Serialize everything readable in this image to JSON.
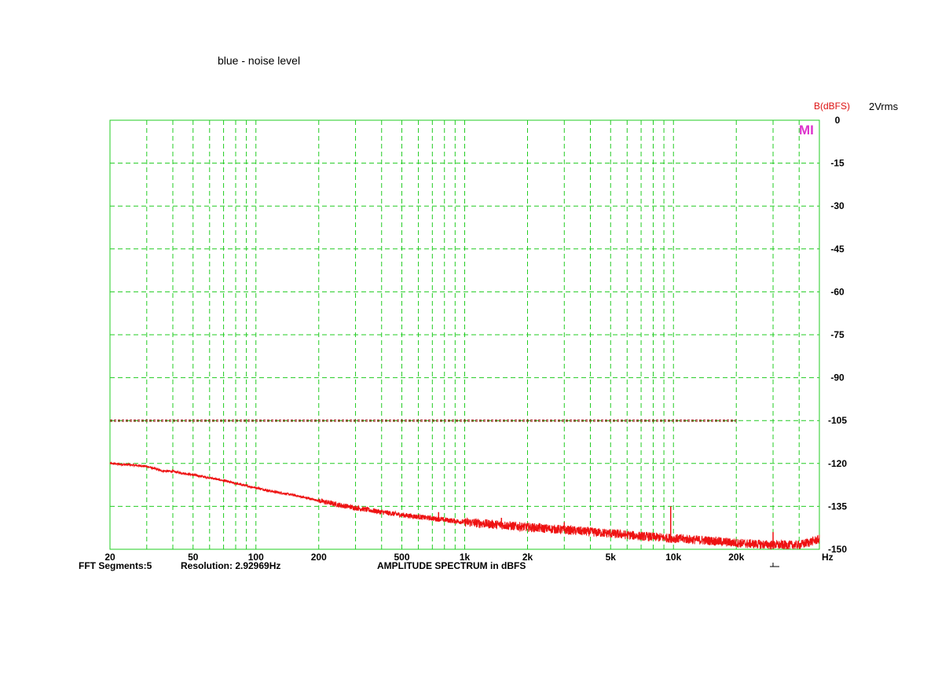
{
  "colors": {
    "grid": "#22cc22",
    "trace": "#ee1111",
    "ref_line": "#991111",
    "axis_unit": "#dd1111",
    "marker": "#dd33cc",
    "text": "#000000"
  },
  "chart_data": {
    "type": "line",
    "title": "blue - noise level",
    "ylabel": "B(dBFS)",
    "level_note": "2Vrms",
    "xunit": "Hz",
    "xscale": "log",
    "xlim": [
      20,
      50000
    ],
    "ylim": [
      -150,
      0
    ],
    "grid": true,
    "xtick_values": [
      20,
      50,
      100,
      200,
      500,
      1000,
      2000,
      5000,
      10000,
      20000
    ],
    "xtick_labels": [
      "20",
      "50",
      "100",
      "200",
      "500",
      "1k",
      "2k",
      "5k",
      "10k",
      "20k"
    ],
    "ytick_values": [
      0,
      -15,
      -30,
      -45,
      -60,
      -75,
      -90,
      -105,
      -120,
      -135,
      -150
    ],
    "ytick_labels": [
      "0",
      "-15",
      "-30",
      "-45",
      "-60",
      "-75",
      "-90",
      "-105",
      "-120",
      "-135",
      "-150"
    ],
    "marker_label": "MI",
    "footer": {
      "segments": "FFT Segments:5",
      "resolution": "Resolution: 2.92969Hz",
      "description": "AMPLITUDE SPECTRUM in dBFS"
    },
    "series": [
      {
        "x": [
          20,
          25,
          30,
          35,
          40,
          50,
          60,
          70,
          80,
          100,
          120,
          150,
          200,
          250,
          300,
          400,
          500,
          700,
          1000,
          1500,
          2000,
          3000,
          5000,
          7000,
          10000,
          15000,
          20000,
          30000,
          40000,
          50000
        ],
        "y": [
          -120,
          -120.5,
          -121,
          -122.5,
          -122.8,
          -124,
          -125,
          -126,
          -127,
          -128.5,
          -129.8,
          -131,
          -133,
          -134.5,
          -135.5,
          -137,
          -138,
          -139.2,
          -140.5,
          -141.5,
          -142.3,
          -143.2,
          -144.5,
          -145.4,
          -146.2,
          -147,
          -147.8,
          -148.5,
          -148.5,
          -146.5
        ]
      }
    ],
    "spikes": [
      {
        "x": 750,
        "y": -137
      },
      {
        "x": 1500,
        "y": -139
      },
      {
        "x": 3000,
        "y": -140.5
      },
      {
        "x": 9700,
        "y": -135
      },
      {
        "x": 30000,
        "y": -144
      }
    ],
    "reference_lines": [
      {
        "y": -104.8,
        "xmax": 20000
      },
      {
        "y": -105.3,
        "xmax": 20000
      }
    ]
  }
}
